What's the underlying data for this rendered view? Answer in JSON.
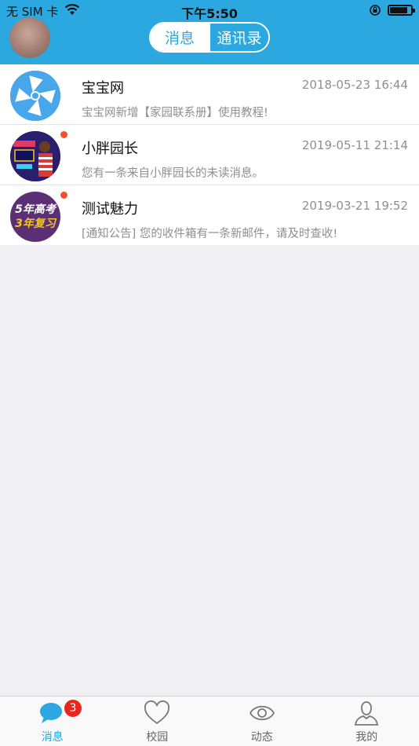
{
  "status_bar": {
    "carrier": "无 SIM 卡",
    "time": "下午5:50"
  },
  "header": {
    "segments": [
      {
        "label": "消息",
        "active": false
      },
      {
        "label": "通讯录",
        "active": true
      }
    ]
  },
  "conversations": [
    {
      "name": "宝宝网",
      "time": "2018-05-23 16:44",
      "message": "宝宝网新增【家园联系册】使用教程!",
      "unread": false
    },
    {
      "name": "小胖园长",
      "time": "2019-05-11 21:14",
      "message": "您有一条来自小胖园长的未读消息。",
      "unread": true
    },
    {
      "name": "测试魅力",
      "time": "2019-03-21 19:52",
      "message": "[通知公告] 您的收件箱有一条新邮件，请及时查收!",
      "unread": true,
      "avatar_text": [
        "5年高考",
        "3年复习"
      ]
    }
  ],
  "tabbar": {
    "tabs": [
      {
        "label": "消息",
        "icon": "chat-bubble-icon",
        "active": true,
        "badge": "3"
      },
      {
        "label": "校园",
        "icon": "heart-icon",
        "active": false
      },
      {
        "label": "动态",
        "icon": "eye-icon",
        "active": false
      },
      {
        "label": "我的",
        "icon": "person-icon",
        "active": false
      }
    ]
  },
  "colors": {
    "header_blue": "#2aa8df",
    "unread_dot": "#f2512a",
    "badge_red": "#e8261b"
  }
}
